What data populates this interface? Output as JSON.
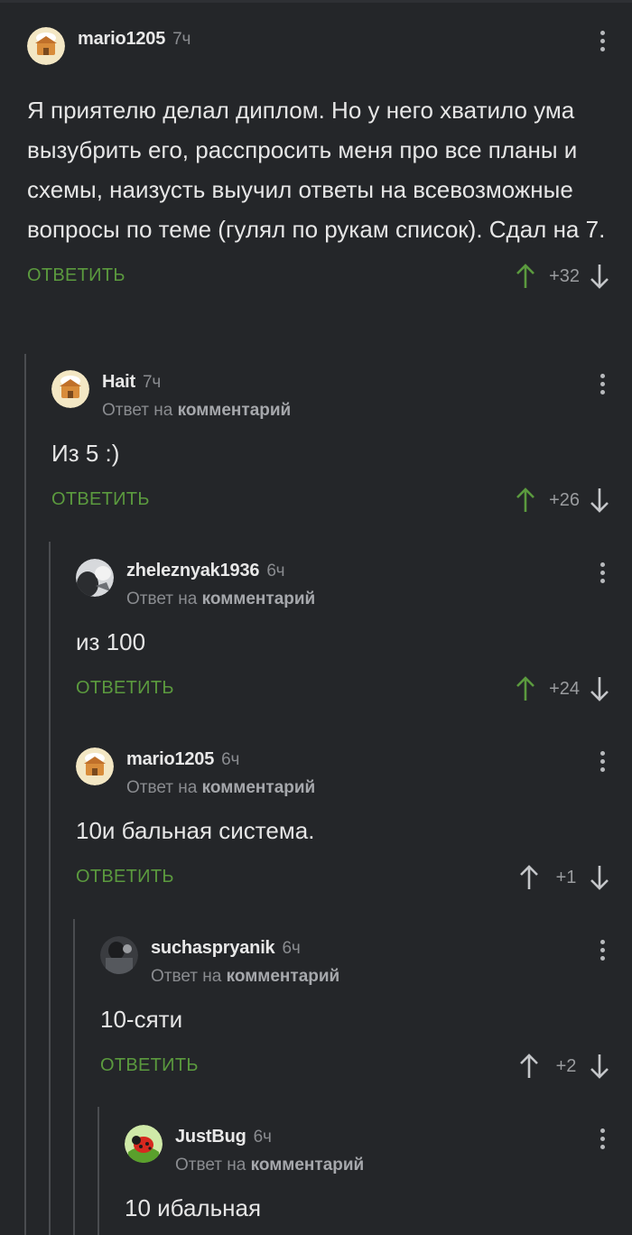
{
  "reply_label": "ОТВЕТИТЬ",
  "reply_to_prefix": "Ответ на",
  "reply_to_link": "комментарий",
  "colors": {
    "background": "#242629",
    "accent_green": "#5b9a3e",
    "upvoted_arrow": "#5b9a3e",
    "neutral_arrow": "#c4c6c9",
    "thread_line": "#4a4c50"
  },
  "comments": [
    {
      "author": "mario1205",
      "time": "7ч",
      "text": "Я приятелю делал диплом. Но у него хватило ума вызубрить его, расспросить меня про все планы и схемы, наизусть выучил ответы на всевозможные вопросы по теме (гулял по рукам список). Сдал на 7.",
      "votes": "+32",
      "avatar": "chef-hut-avatar"
    },
    {
      "author": "Hait",
      "time": "7ч",
      "text": "Из 5 :)",
      "votes": "+26",
      "avatar": "chef-hut-avatar"
    },
    {
      "author": "zheleznyak1936",
      "time": "6ч",
      "text": "из 100",
      "votes": "+24",
      "avatar": "photo-avatar"
    },
    {
      "author": "mario1205",
      "time": "6ч",
      "text": "10и бальная система.",
      "votes": "+1",
      "avatar": "chef-hut-avatar"
    },
    {
      "author": "suchaspryanik",
      "time": "6ч",
      "text": "10-сяти",
      "votes": "+2",
      "avatar": "photo-avatar"
    },
    {
      "author": "JustBug",
      "time": "6ч",
      "text": "10 ибальная",
      "avatar": "ladybug-avatar"
    }
  ]
}
